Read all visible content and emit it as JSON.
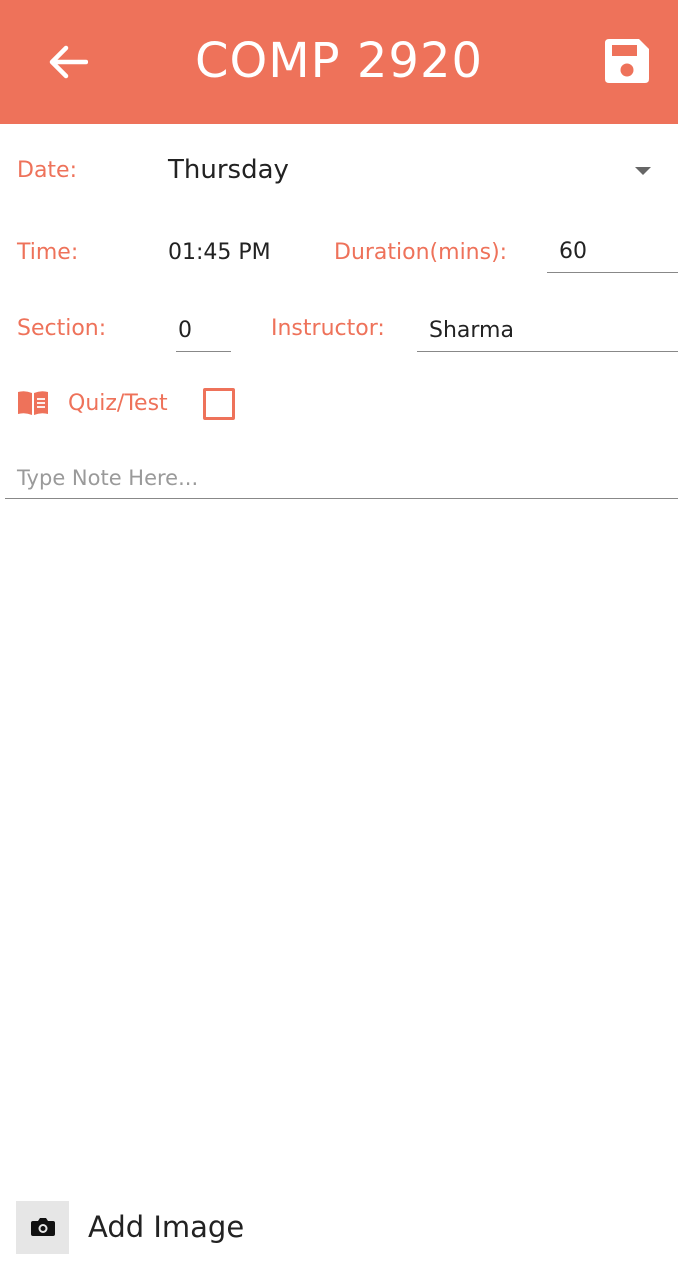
{
  "header": {
    "title": "COMP 2920",
    "background_color": "#ee725a",
    "back_icon": "arrow-left-icon",
    "save_icon": "floppy-disk-icon"
  },
  "form": {
    "date_label": "Date:",
    "date_value": "Thursday",
    "time_label": "Time:",
    "time_value": "01:45 PM",
    "duration_label": "Duration(mins):",
    "duration_value": "60",
    "section_label": "Section:",
    "section_value": "0",
    "instructor_label": "Instructor:",
    "instructor_value": "Sharma",
    "quiz_label": "Quiz/Test",
    "quiz_icon": "book-open-icon",
    "quiz_checked": false,
    "note_placeholder": "Type Note Here..."
  },
  "footer": {
    "add_image_label": "Add Image",
    "camera_icon": "camera-icon"
  },
  "colors": {
    "accent": "#ee725a",
    "text": "#222222",
    "placeholder": "#9a9a9a"
  }
}
